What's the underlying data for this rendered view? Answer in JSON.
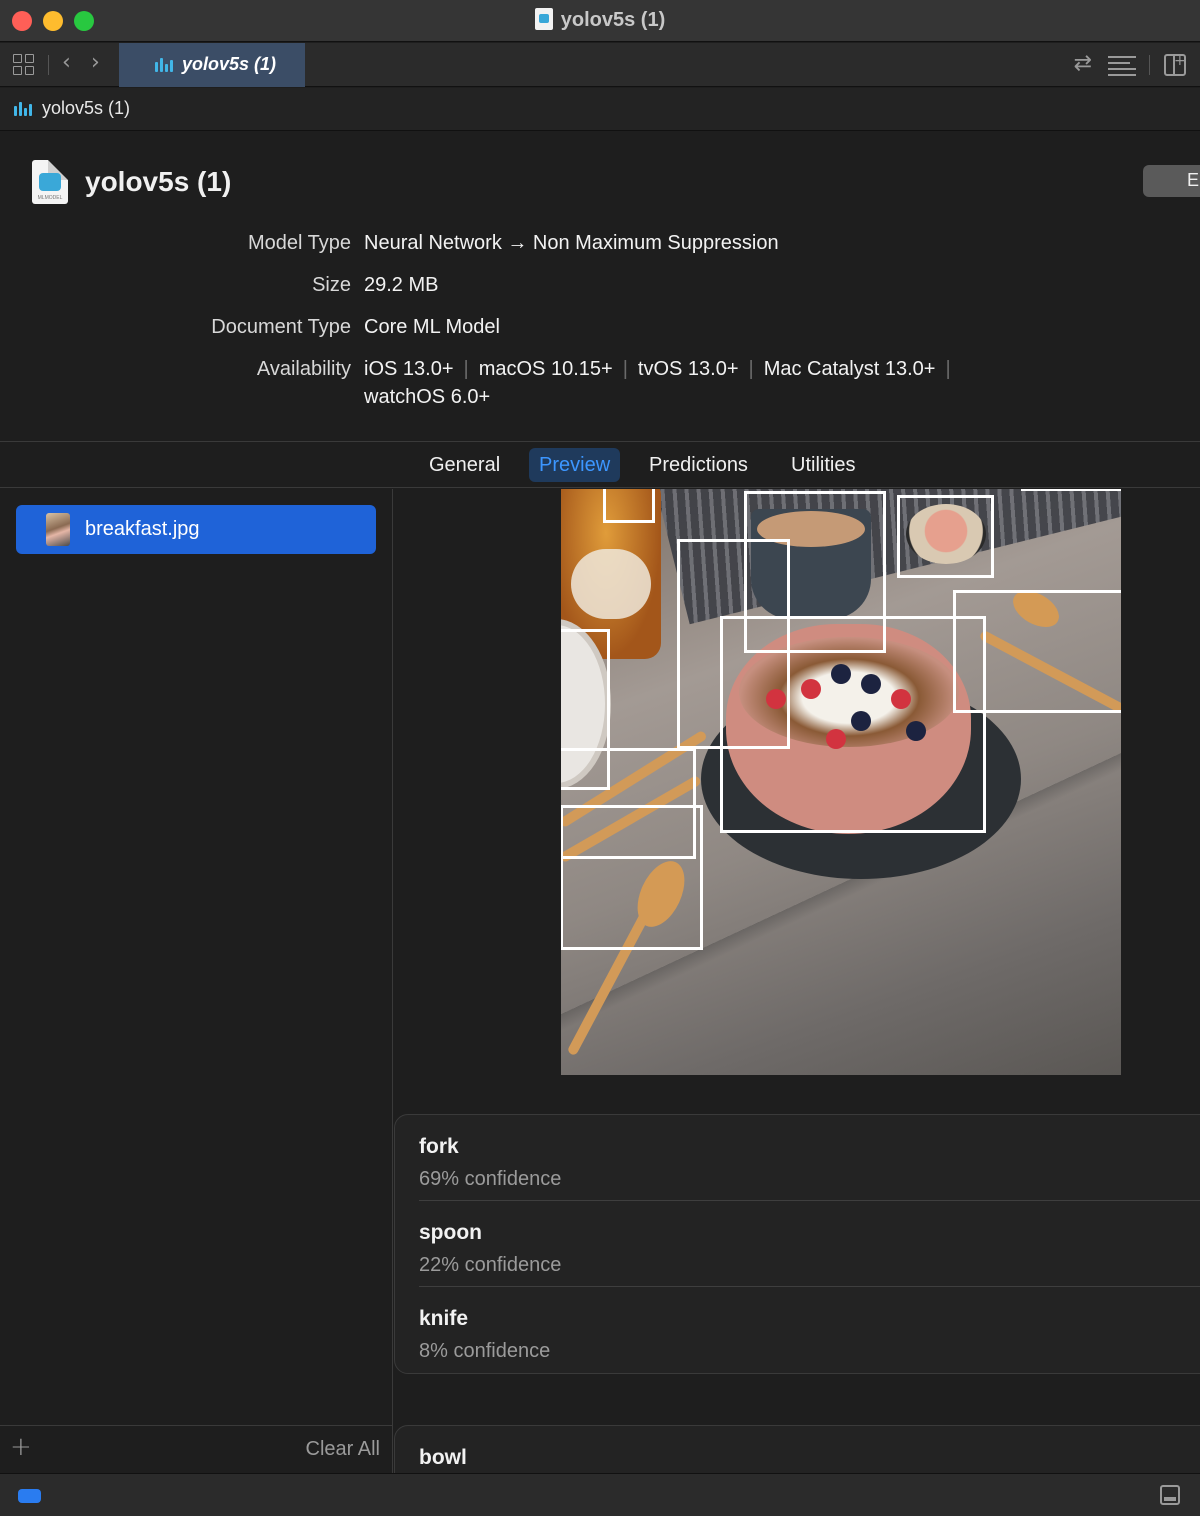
{
  "window": {
    "title": "yolov5s (1)"
  },
  "toolbar": {
    "active_tab": "yolov5s (1)"
  },
  "breadcrumb": {
    "item": "yolov5s (1)"
  },
  "header": {
    "model_name": "yolov5s (1)",
    "icon_caption": "MLMODEL",
    "edit_button_label": "E",
    "metadata": [
      {
        "key": "Model Type",
        "value": "Neural Network → Non Maximum Suppression"
      },
      {
        "key": "Size",
        "value": "29.2 MB"
      },
      {
        "key": "Document Type",
        "value": "Core ML Model"
      }
    ],
    "availability": {
      "key": "Availability",
      "platforms": [
        "iOS 13.0+",
        "macOS 10.15+",
        "tvOS 13.0+",
        "Mac Catalyst 13.0+"
      ],
      "platforms_line2": [
        "watchOS 6.0+"
      ]
    }
  },
  "tabs": [
    {
      "label": "General",
      "active": false
    },
    {
      "label": "Preview",
      "active": true
    },
    {
      "label": "Predictions",
      "active": false
    },
    {
      "label": "Utilities",
      "active": false
    }
  ],
  "sidebar": {
    "files": [
      {
        "name": "breakfast.jpg",
        "selected": true
      }
    ],
    "add_label": "+",
    "clear_all_label": "Clear All"
  },
  "predictions": {
    "selected_group": [
      {
        "label": "fork",
        "confidence": "69% confidence"
      },
      {
        "label": "spoon",
        "confidence": "22% confidence"
      },
      {
        "label": "knife",
        "confidence": "8% confidence"
      }
    ],
    "next_group": [
      {
        "label": "bowl"
      }
    ]
  },
  "colors": {
    "accent": "#1f63d8",
    "segment_active_text": "#3c96ff",
    "bounding_box": "#ffffff",
    "background": "#1e1e1e"
  }
}
